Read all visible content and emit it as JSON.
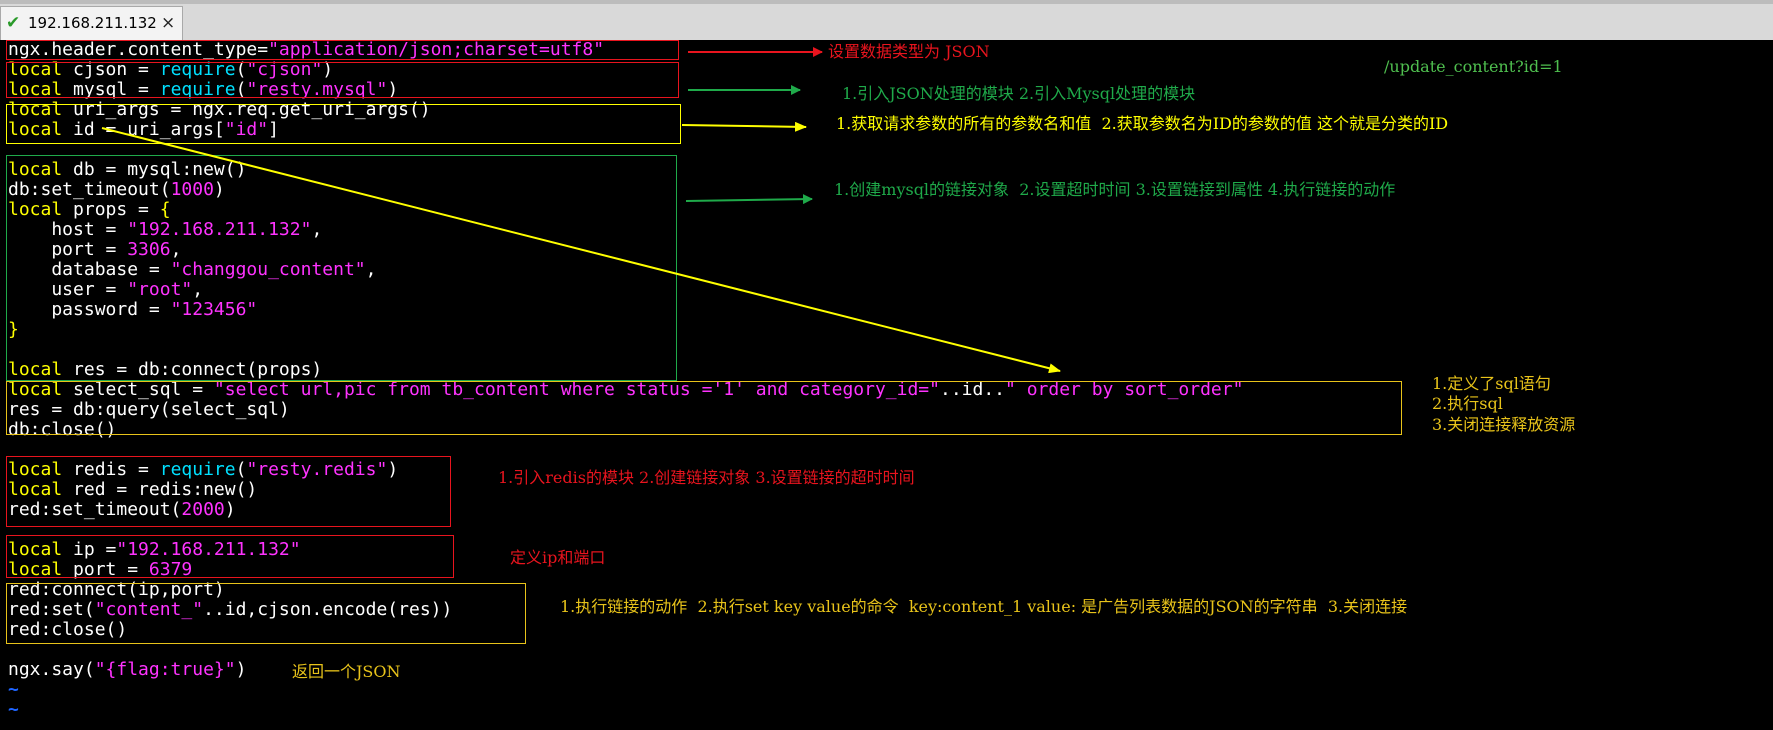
{
  "tab": {
    "title": "192.168.211.132",
    "close": "×"
  },
  "url": "/update_content?id=1",
  "code": {
    "l1": [
      "ngx.header.content_type=",
      "\"application/json;charset=utf8\""
    ],
    "l2": [
      "local",
      " cjson = ",
      "require",
      "(",
      "\"cjson\"",
      ")"
    ],
    "l3": [
      "local",
      " mysql = ",
      "require",
      "(",
      "\"resty.mysql\"",
      ")"
    ],
    "l4": [
      "local",
      " uri_args = ngx.req.get_uri_args()"
    ],
    "l5": [
      "local",
      " id = uri_args[",
      "\"id\"",
      "]"
    ],
    "l7": [
      "local",
      " db = mysql:new()"
    ],
    "l8": [
      "db:set_timeout(",
      "1000",
      ")"
    ],
    "l9": [
      "local",
      " props = ",
      "{"
    ],
    "l10": [
      "    host = ",
      "\"192.168.211.132\"",
      ","
    ],
    "l11": [
      "    port = ",
      "3306",
      ","
    ],
    "l12": [
      "    database = ",
      "\"changgou_content\"",
      ","
    ],
    "l13": [
      "    user = ",
      "\"root\"",
      ","
    ],
    "l14": [
      "    password = ",
      "\"123456\""
    ],
    "l15": [
      "}"
    ],
    "l17": [
      "local",
      " res = db:connect(props)"
    ],
    "l18": [
      "local",
      " select_sql = ",
      "\"select url,pic from tb_content where status ='1' and category_id=\"",
      "..id..",
      "\" order by sort_order\""
    ],
    "l19": [
      "res = db:query(select_sql)"
    ],
    "l20": [
      "db:close()"
    ],
    "l22": [
      "local",
      " redis = ",
      "require",
      "(",
      "\"resty.redis\"",
      ")"
    ],
    "l23": [
      "local",
      " red = redis:new()"
    ],
    "l24": [
      "red:set_timeout(",
      "2000",
      ")"
    ],
    "l26": [
      "local",
      " ip =",
      "\"192.168.211.132\""
    ],
    "l27": [
      "local",
      " port = ",
      "6379"
    ],
    "l28": [
      "red:connect(ip,port)"
    ],
    "l29": [
      "red:set(",
      "\"content_\"",
      "..id,cjson.encode(res))"
    ],
    "l30": [
      "red:close()"
    ],
    "l32": [
      "ngx.say(",
      "\"{flag:true}\"",
      ")"
    ],
    "tilde": "~"
  },
  "notes": {
    "n1": "设置数据类型为 JSON",
    "n2": "1.引入JSON处理的模块 2.引入Mysql处理的模块",
    "n3": "1.获取请求参数的所有的参数名和值  2.获取参数名为ID的参数的值 这个就是分类的ID",
    "n4": "1.创建mysql的链接对象  2.设置超时时间 3.设置链接到属性 4.执行链接的动作",
    "n5a": "1.定义了sql语句",
    "n5b": "2.执行sql",
    "n5c": "3.关闭连接释放资源",
    "n6": "1.引入redis的模块 2.创建链接对象 3.设置链接的超时时间",
    "n7": "定义ip和端口",
    "n8": "1.执行链接的动作  2.执行set key value的命令  key:content_1 value: 是广告列表数据的JSON的字符串  3.关闭连接",
    "n9": "返回一个JSON"
  },
  "colors": {
    "red": "#e8141e",
    "green": "#1faa4a",
    "yellow": "#ffff00",
    "orange": "#e8c31a"
  }
}
